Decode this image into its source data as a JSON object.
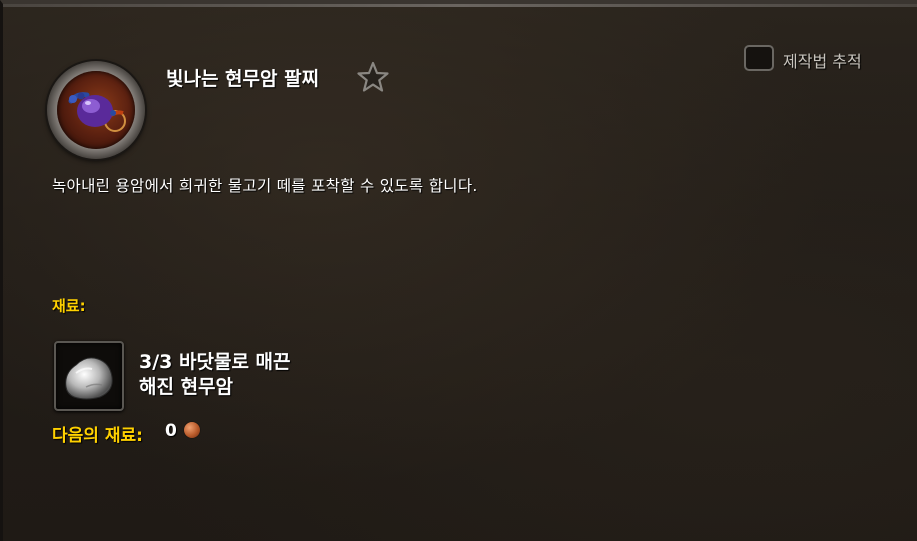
{
  "recipe": {
    "title": "빛나는 현무암 팔찌",
    "icon": "basalt-bracelet-icon",
    "description": "녹아내린 용암에서 희귀한 물고기 떼를 포착할 수 있도록 합니다."
  },
  "track": {
    "label": "제작법 추적",
    "checked": false
  },
  "reagents": {
    "header": "재료:",
    "items": [
      {
        "count": "3/3",
        "name_line1": "바닷물로 매끈",
        "name_line2": "해진 현무암",
        "icon": "smooth-basalt-stone-icon"
      }
    ]
  },
  "next_reagents": {
    "label": "다음의 재료:",
    "value": "0",
    "currency_icon": "copper-coin-icon"
  },
  "colors": {
    "gold_header": "#ffd100",
    "text_white": "#ffffff",
    "background": "#221d18"
  }
}
